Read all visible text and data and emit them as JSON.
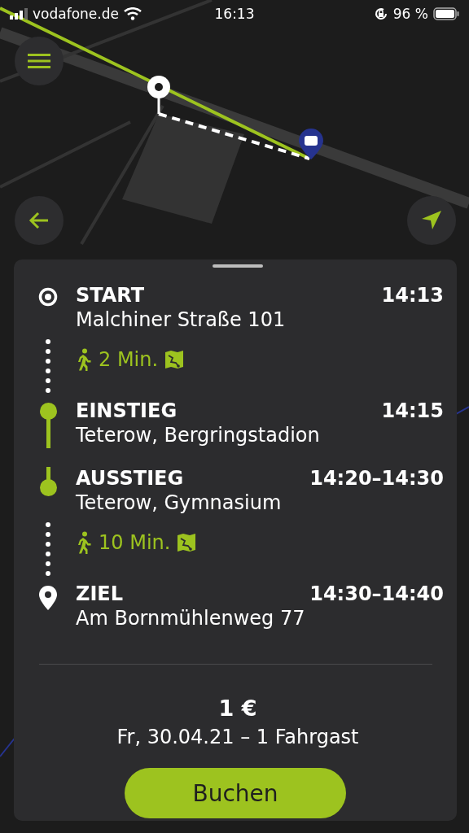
{
  "status_bar": {
    "carrier": "vodafone.de",
    "time": "16:13",
    "battery": "96 %"
  },
  "trip": {
    "legs": [
      {
        "kind": "origin",
        "label": "START",
        "time": "14:13",
        "place": "Malchiner Straße 101"
      },
      {
        "kind": "walk",
        "duration": "2 Min."
      },
      {
        "kind": "board",
        "label": "EINSTIEG",
        "time": "14:15",
        "place": "Teterow, Bergringstadion"
      },
      {
        "kind": "alight",
        "label": "AUSSTIEG",
        "time": "14:20–14:30",
        "place": "Teterow, Gymnasium"
      },
      {
        "kind": "walk",
        "duration": "10 Min."
      },
      {
        "kind": "destination",
        "label": "ZIEL",
        "time": "14:30–14:40",
        "place": "Am Bornmühlenweg 77"
      }
    ],
    "price": "1 €",
    "summary": "Fr, 30.04.21 – 1 Fahrgast",
    "book_button": "Buchen"
  }
}
